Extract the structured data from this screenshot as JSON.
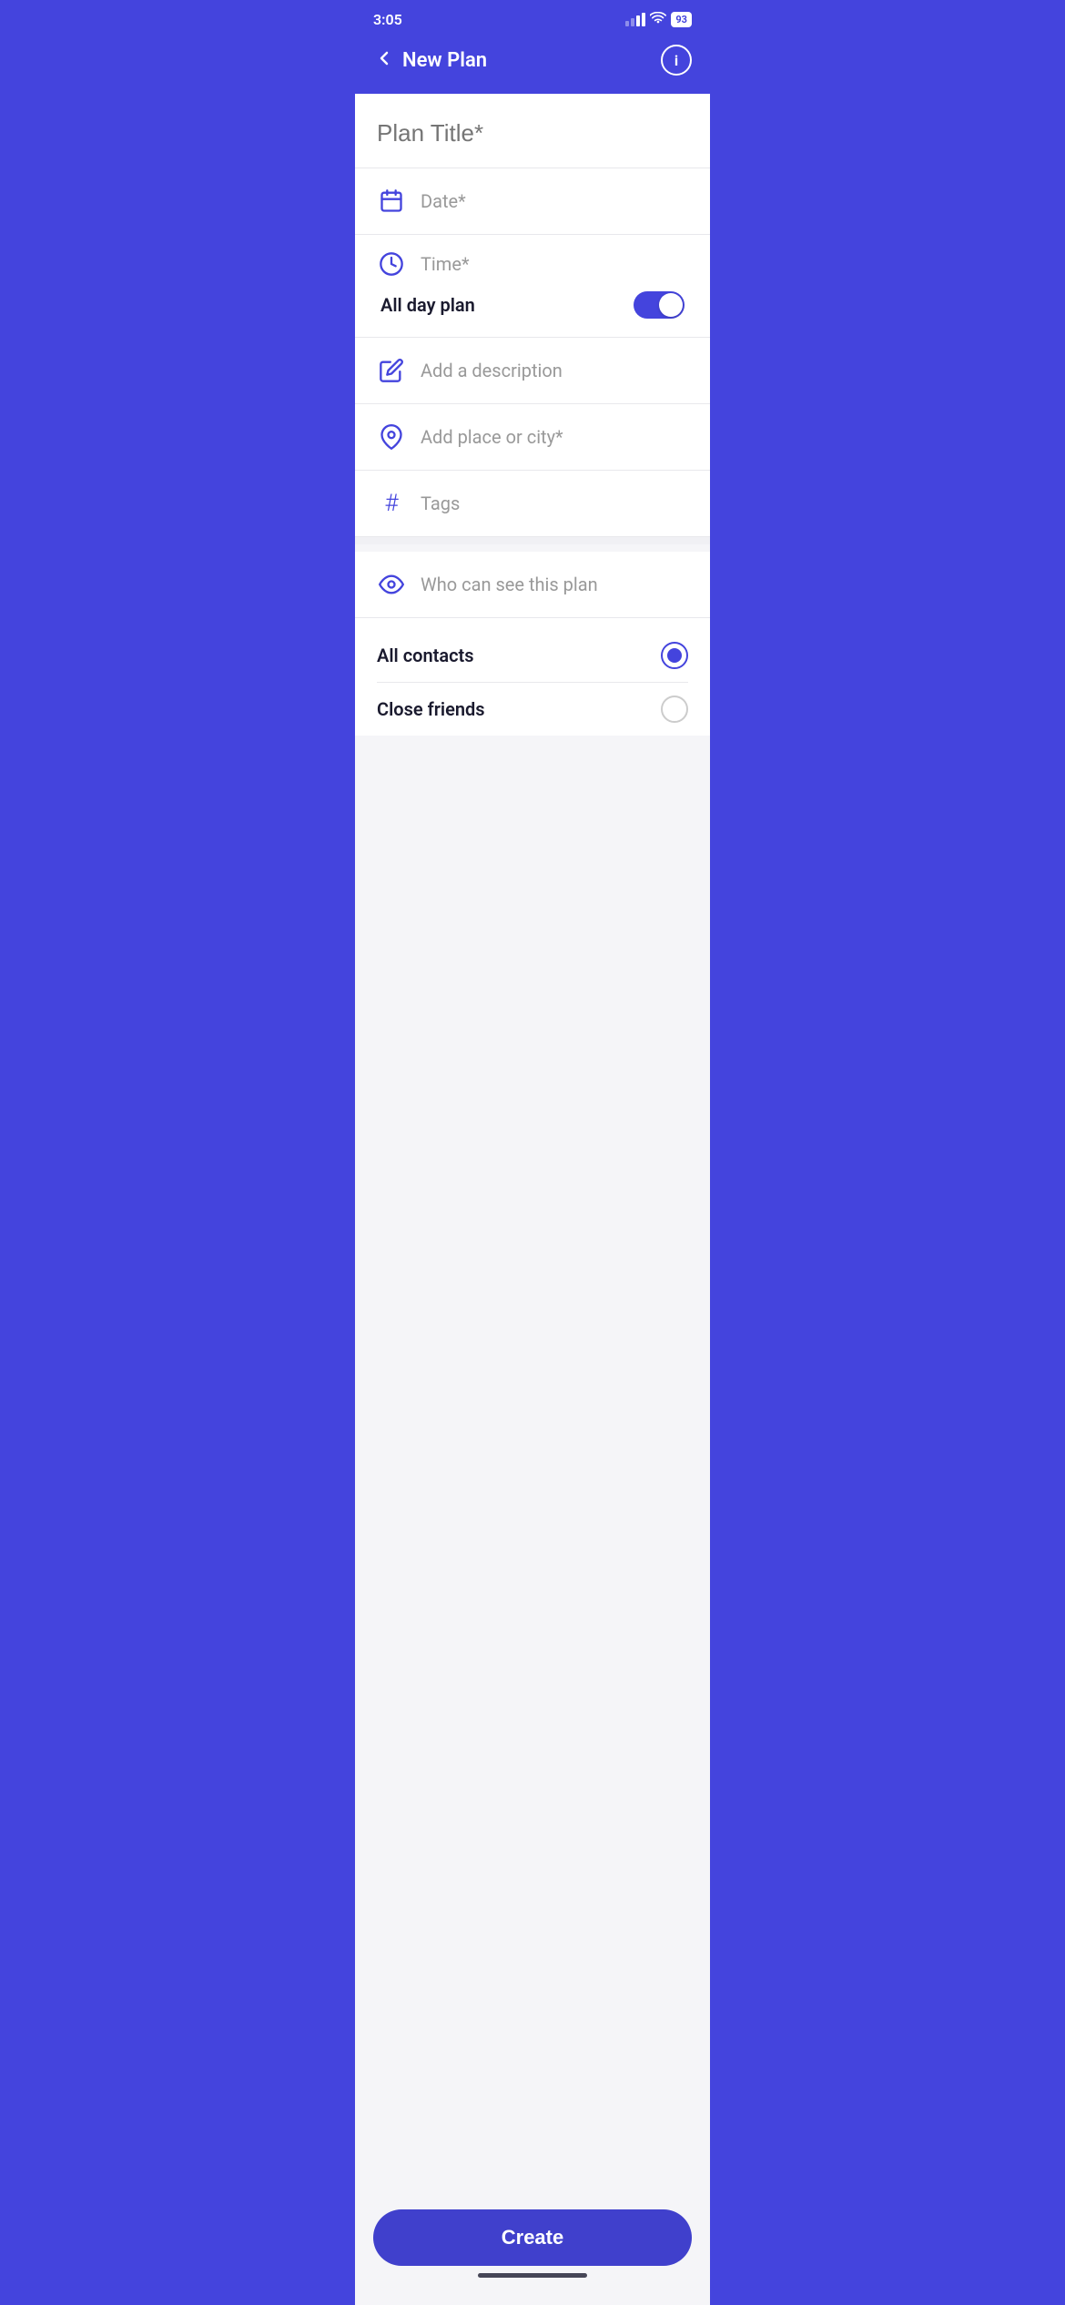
{
  "statusBar": {
    "time": "3:05",
    "battery": "93"
  },
  "header": {
    "title": "New Plan",
    "backLabel": "‹",
    "infoLabel": "i"
  },
  "form": {
    "planTitlePlaceholder": "Plan Title*",
    "dateLabel": "Date*",
    "timeLabel": "Time*",
    "allDayLabel": "All day plan",
    "descriptionLabel": "Add a description",
    "placeLabel": "Add place or city*",
    "tagsLabel": "Tags",
    "visibilityLabel": "Who can see this plan",
    "visibilityOptions": [
      {
        "label": "All contacts",
        "selected": true
      },
      {
        "label": "Close friends",
        "selected": false
      }
    ]
  },
  "footer": {
    "createLabel": "Create"
  },
  "colors": {
    "brand": "#4444dd",
    "brandDark": "#4040cc"
  }
}
